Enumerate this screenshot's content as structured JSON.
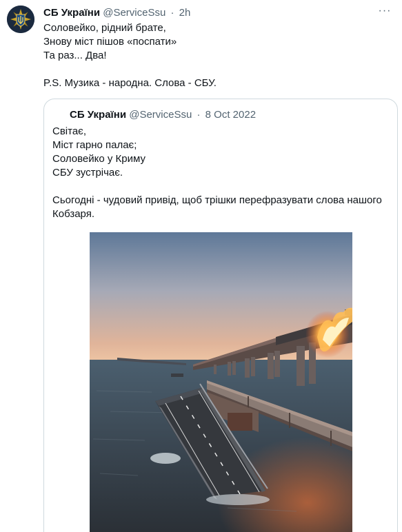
{
  "tweet": {
    "author_name": "СБ України",
    "author_handle": "@ServiceSsu",
    "separator": "·",
    "time": "2h",
    "more": "···",
    "lines": [
      "Соловейко, рідний брате,",
      "Знову міст пішов «поспати»",
      "Та раз... Два!",
      "",
      "P.S. Музика - народна. Слова - СБУ."
    ]
  },
  "quoted": {
    "author_name": "СБ України",
    "author_handle": "@ServiceSsu",
    "separator": "·",
    "date": "8 Oct 2022",
    "lines": [
      "Світає,",
      "Міст гарно палає;",
      "Соловейко у Криму",
      "СБУ зустрічає.",
      "",
      "Сьогодні - чудовий привід, щоб трішки перефразувати слова нашого",
      "Кобзаря."
    ]
  },
  "icons": {
    "avatar": "ssu-emblem-icon",
    "more": "more-horizontal-icon"
  },
  "colors": {
    "text": "#0f1419",
    "secondary": "#536471",
    "border": "#cfd9de",
    "avatar_bg": "#1b2a3f",
    "emblem": "#c9a227"
  }
}
